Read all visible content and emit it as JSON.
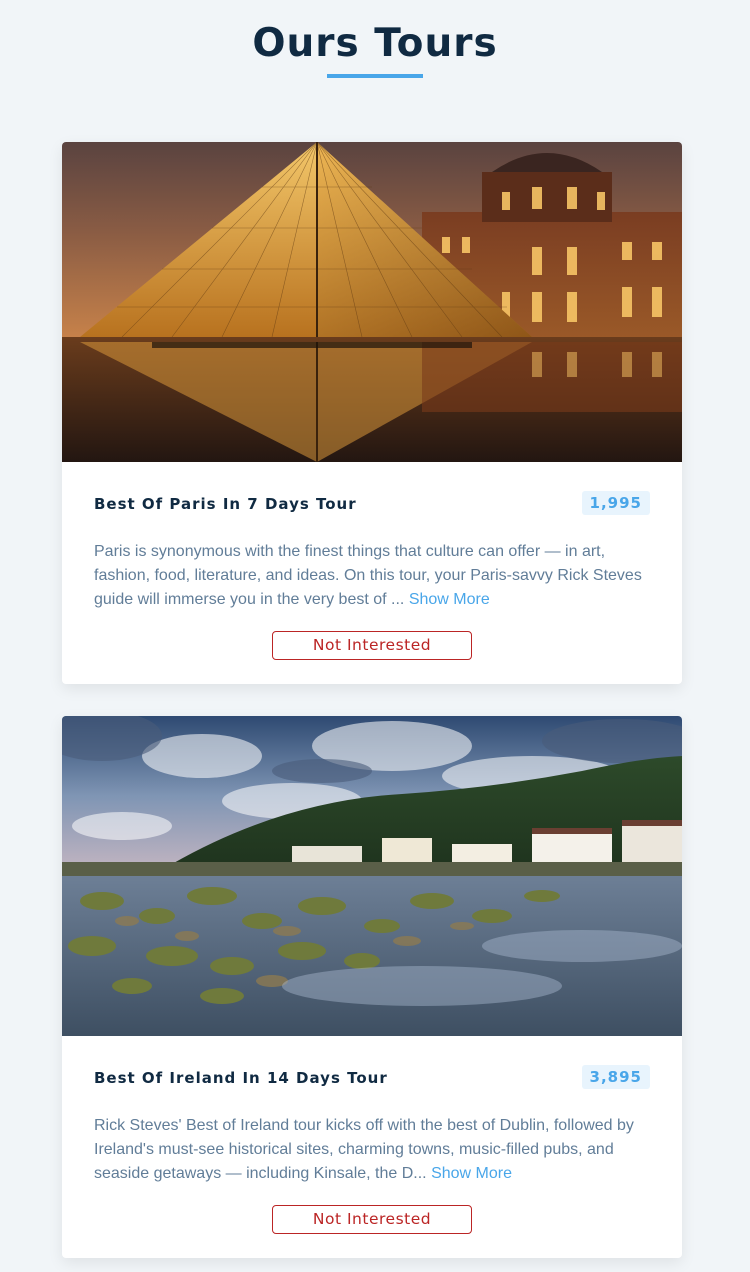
{
  "header": {
    "title": "Ours Tours"
  },
  "tours": [
    {
      "name": "Best Of Paris In 7 Days Tour",
      "price": "1,995",
      "description": "Paris is synonymous with the finest things that culture can offer — in art, fashion, food, literature, and ideas. On this tour, your Paris-savvy Rick Steves guide will immerse you in the very best of ...",
      "show_more": "Show More",
      "button": "Not Interested",
      "image_subject": "Louvre pyramid at dusk"
    },
    {
      "name": "Best Of Ireland In 14 Days Tour",
      "price": "3,895",
      "description": "Rick Steves' Best of Ireland tour kicks off with the best of Dublin, followed by Ireland's must-see historical sites, charming towns, music-filled pubs, and seaside getaways — including Kinsale, the D...",
      "show_more": "Show More",
      "button": "Not Interested",
      "image_subject": "Irish coastal village with rocky shore"
    }
  ],
  "colors": {
    "accent": "#49a6e9",
    "danger": "#bb2525",
    "heading": "#102a42",
    "body_text": "#617d98",
    "background": "#f1f5f8"
  }
}
